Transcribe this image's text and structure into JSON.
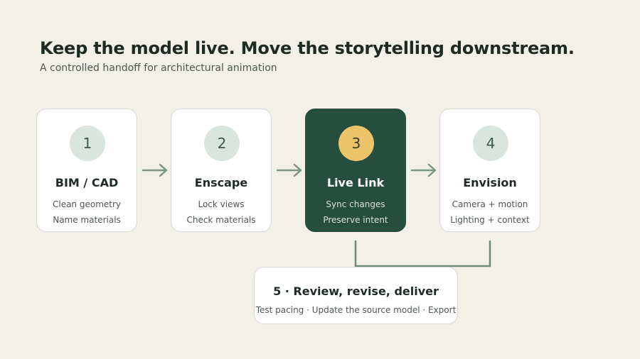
{
  "header": {
    "title": "Keep the model live. Move the storytelling downstream.",
    "subtitle": "A controlled handoff for architectural animation"
  },
  "steps": [
    {
      "number": "1",
      "title": "BIM / CAD",
      "lines": [
        "Clean geometry",
        "Name materials"
      ]
    },
    {
      "number": "2",
      "title": "Enscape",
      "lines": [
        "Lock views",
        "Check materials"
      ]
    },
    {
      "number": "3",
      "title": "Live Link",
      "lines": [
        "Sync changes",
        "Preserve intent"
      ],
      "highlighted": true
    },
    {
      "number": "4",
      "title": "Envision",
      "lines": [
        "Camera + motion",
        "Lighting + context"
      ]
    }
  ],
  "final_step": {
    "title": "5 · Review, revise, deliver",
    "description": "Test pacing · Update the source model · Export"
  },
  "colors": {
    "background": "#f3f0ea",
    "highlight_card": "#264e3f",
    "highlight_badge": "#ecc46a",
    "badge": "#d8e6de",
    "arrow": "#7d9486",
    "connector": "#6f8a7b"
  }
}
